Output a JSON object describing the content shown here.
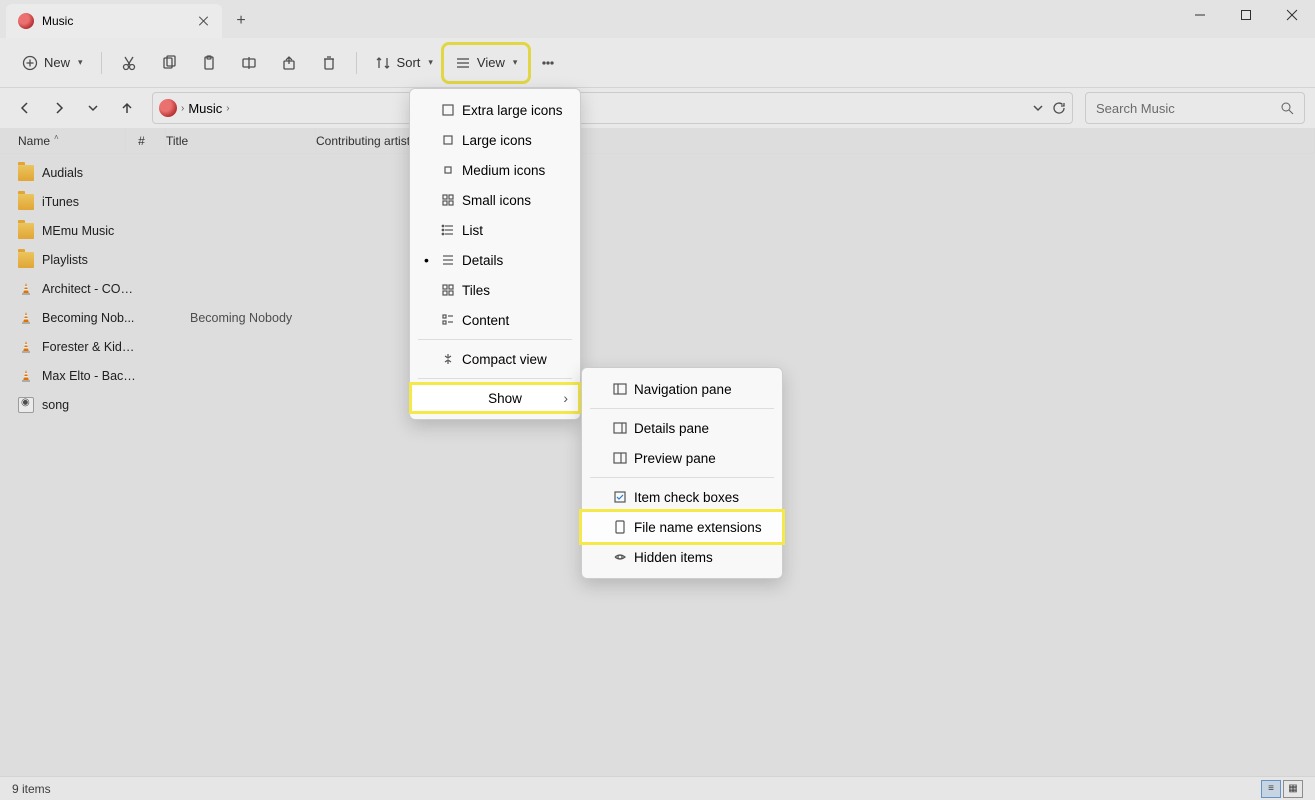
{
  "tab": {
    "title": "Music"
  },
  "toolbar": {
    "new": "New",
    "sort": "Sort",
    "view": "View"
  },
  "breadcrumb": {
    "location": "Music"
  },
  "search": {
    "placeholder": "Search Music"
  },
  "columns": {
    "name": "Name",
    "number": "#",
    "title": "Title",
    "artist": "Contributing artist"
  },
  "files": [
    {
      "name": "Audials",
      "type": "folder"
    },
    {
      "name": "iTunes",
      "type": "folder"
    },
    {
      "name": "MEmu Music",
      "type": "folder"
    },
    {
      "name": "Playlists",
      "type": "folder"
    },
    {
      "name": "Architect - COL...",
      "type": "vlc"
    },
    {
      "name": "Becoming Nob...",
      "type": "vlc",
      "title": "Becoming Nobody"
    },
    {
      "name": "Forester & Kidn...",
      "type": "vlc"
    },
    {
      "name": "Max Elto - Back...",
      "type": "vlc"
    },
    {
      "name": "song",
      "type": "generic"
    }
  ],
  "viewMenu": {
    "extraLarge": "Extra large icons",
    "large": "Large icons",
    "medium": "Medium icons",
    "small": "Small icons",
    "list": "List",
    "details": "Details",
    "tiles": "Tiles",
    "content": "Content",
    "compact": "Compact view",
    "show": "Show"
  },
  "showMenu": {
    "nav": "Navigation pane",
    "detailsPane": "Details pane",
    "preview": "Preview pane",
    "checkboxes": "Item check boxes",
    "extensions": "File name extensions",
    "hidden": "Hidden items"
  },
  "status": {
    "count": "9 items"
  }
}
